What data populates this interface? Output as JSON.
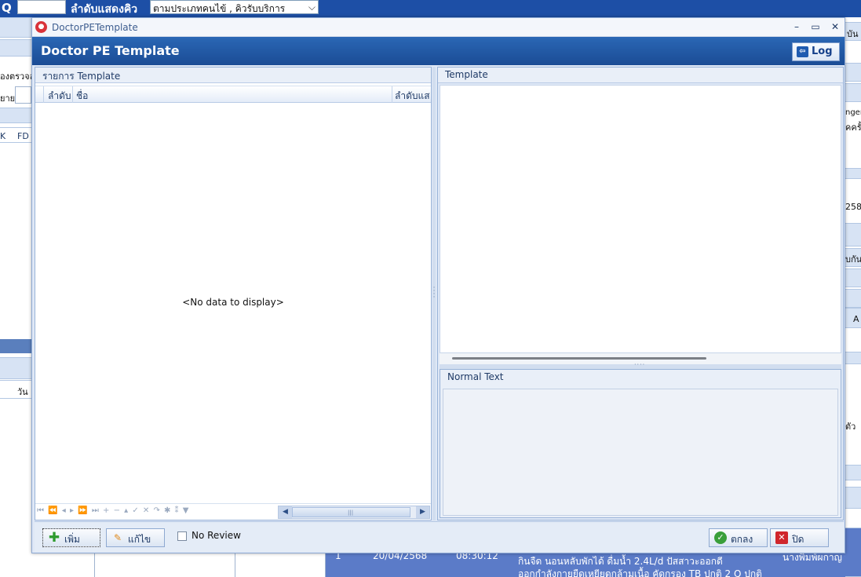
{
  "background": {
    "topbar": {
      "q_label": "Q",
      "order_label": "ลำดับแสดงคิว",
      "order_select": "ตามประเภทคนไข้ , คิวรับบริการ"
    },
    "left_texts": [
      "องตรวจล",
      "ยาย",
      "K",
      "FD",
      "วัน"
    ],
    "right_texts": [
      "บัน",
      "nger",
      "คครั้",
      "258",
      "บกัน",
      "A",
      "ตัว"
    ],
    "bottom_row": {
      "date": "20/04/2568",
      "time": "08:30:12",
      "note_line1": "กินจืด นอนหลับพักได้  ดื่มน้ำ 2.4L/d ปัสสาวะออกดี",
      "note_line2": "ออกกำลังกายยืดเหยียดกล้ามเนื้อ คัดกรอง TB ปกติ 2 Q ปกติ",
      "person": "นางพิมพ์ผกาญ  พลล"
    }
  },
  "dialog": {
    "window_title": "DoctorPETemplate",
    "heading": "Doctor PE Template",
    "log_label": "Log",
    "left_panel": {
      "caption": "รายการ Template",
      "columns": [
        "ลำดับ",
        "ชื่อ",
        "ลำดับแส"
      ],
      "empty_text": "<No data to display>",
      "nav_icons": "⏮ ⏪ ◂ ▸ ⏩ ⏭ + − ▴ ✓ ✕ ↷ ✱ ⁑ ▼"
    },
    "right_panel": {
      "template_caption": "Template",
      "normal_caption": "Normal Text"
    },
    "footer": {
      "add_label": "เพิ่ม",
      "edit_label": "แก้ไข",
      "no_review_label": "No Review",
      "ok_label": "ตกลง",
      "close_label": "ปิด"
    }
  }
}
